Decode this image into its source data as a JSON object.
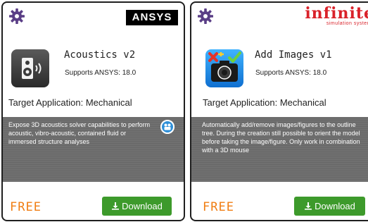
{
  "cards": [
    {
      "brand": {
        "text_main": "ANSYS",
        "accent_color": "#f6b500"
      },
      "icon": "speaker-icon",
      "title": "Acoustics v2",
      "supports": "Supports ANSYS: 18.0",
      "target": "Target Application: Mechanical",
      "description": "Expose 3D acoustics solver capabilities to perform acoustic, vibro-acoustic, contained fluid or immersed structure analyses",
      "has_video_icon": true,
      "price": "FREE",
      "download_label": "Download"
    },
    {
      "brand": {
        "word": "infinite",
        "sub": "simulation systems",
        "color": "#d9222a"
      },
      "icon": "camera-add-icon",
      "title": "Add Images v1",
      "supports": "Supports ANSYS: 18.0",
      "target": "Target Application: Mechanical",
      "description": "Automatically add/remove images/figures to the outline tree. During the creation still possible to orient the model before taking the image/figure. Only work in combination with a 3D mouse",
      "has_video_icon": false,
      "price": "FREE",
      "download_label": "Download"
    }
  ],
  "colors": {
    "free": "#f07d12",
    "download": "#3d9a2b",
    "panel": "#707070"
  }
}
